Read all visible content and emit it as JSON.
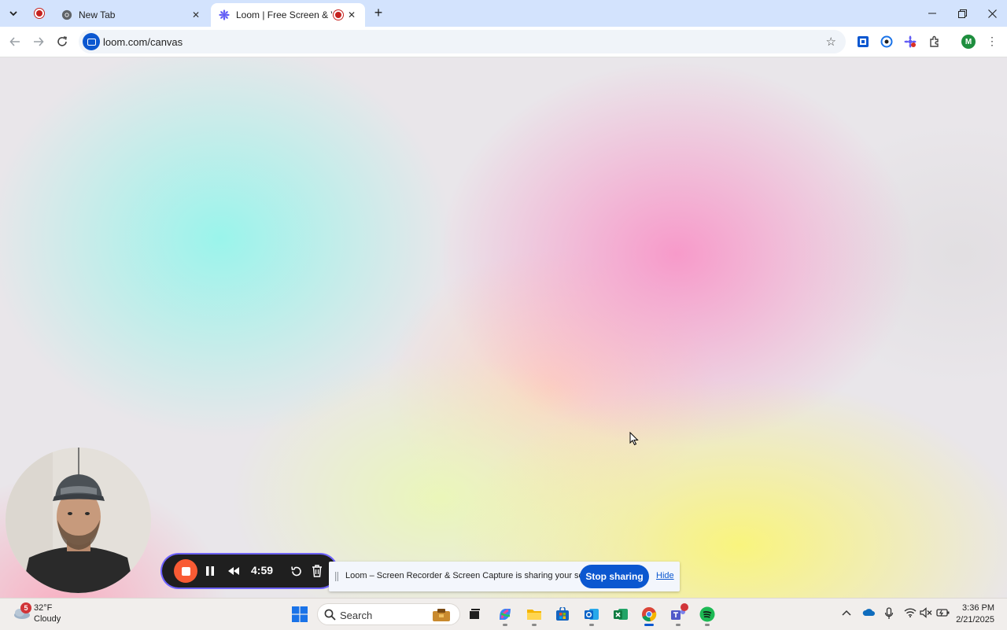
{
  "browser": {
    "tabs": [
      {
        "title": "New Tab",
        "favicon": "chrome-icon",
        "active": false
      },
      {
        "title": "Loom | Free Screen & Video Recording",
        "favicon": "loom-icon",
        "active": true
      }
    ],
    "new_tab_label": "+",
    "url": "loom.com/canvas",
    "profile_initial": "M"
  },
  "recording": {
    "timer": "4:59"
  },
  "share_bar": {
    "message": "Loom – Screen Recorder & Screen Capture is sharing your screen.",
    "stop_label": "Stop sharing",
    "hide_label": "Hide"
  },
  "taskbar": {
    "weather_badge": "5",
    "temperature": "32°F",
    "condition": "Cloudy",
    "search_label": "Search",
    "time": "3:36 PM",
    "date": "2/21/2025"
  },
  "colors": {
    "loom_accent": "#f95b34",
    "chrome_blue": "#0b57d0",
    "tabstrip": "#d3e3fd"
  }
}
